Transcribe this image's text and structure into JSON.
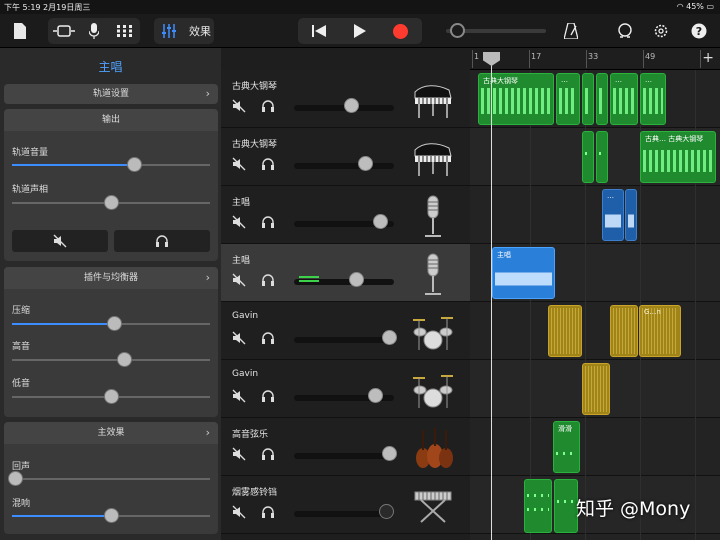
{
  "status": {
    "time_date": "下午 5:19   2月19日周三",
    "battery": "45%"
  },
  "toolbar": {
    "fx_label": "效果",
    "colors": {
      "accent": "#3c8dff",
      "record": "#ff3b30"
    }
  },
  "left_panel": {
    "title": "主唱",
    "track_settings": "轨道设置",
    "output_header": "输出",
    "track_volume": {
      "label": "轨道音量",
      "level": 0.62
    },
    "track_pan": {
      "label": "轨道声相",
      "level": 0.5
    },
    "plugins_header": "插件与均衡器",
    "compressor": {
      "label": "压缩",
      "level": 0.52
    },
    "treble": {
      "label": "高音",
      "level": 0.57
    },
    "bass": {
      "label": "低音",
      "level": 0.5
    },
    "master_effects_header": "主效果",
    "echo": {
      "label": "回声",
      "level": 0.02
    },
    "reverb": {
      "label": "混响",
      "level": 0.5
    }
  },
  "tracks": [
    {
      "name": "古典大钢琴",
      "icon": "grand-piano-icon",
      "volume": 0.57
    },
    {
      "name": "古典大钢琴",
      "icon": "grand-piano-icon",
      "volume": 0.71
    },
    {
      "name": "主唱",
      "icon": "microphone-icon",
      "volume": 0.86
    },
    {
      "name": "主唱",
      "icon": "microphone-icon",
      "volume": 0.62,
      "selected": true
    },
    {
      "name": "Gavin",
      "icon": "drum-kit-icon",
      "volume": 0.95
    },
    {
      "name": "Gavin",
      "icon": "drum-kit-icon",
      "volume": 0.81
    },
    {
      "name": "高音弦乐",
      "icon": "strings-icon",
      "volume": 0.95
    },
    {
      "name": "烟雾感铃铛",
      "icon": "keyboard-stand-icon",
      "volume": 0.92
    }
  ],
  "ruler": {
    "bars": [
      "1",
      "17",
      "33",
      "49"
    ]
  },
  "regions": {
    "piano1": "古典大钢琴",
    "dots": "…",
    "piano2": "古典… 古典大钢琴",
    "vocal": "主唱",
    "drums": "G…n",
    "strings": "滑滑"
  },
  "watermark": "知乎 @Mony"
}
